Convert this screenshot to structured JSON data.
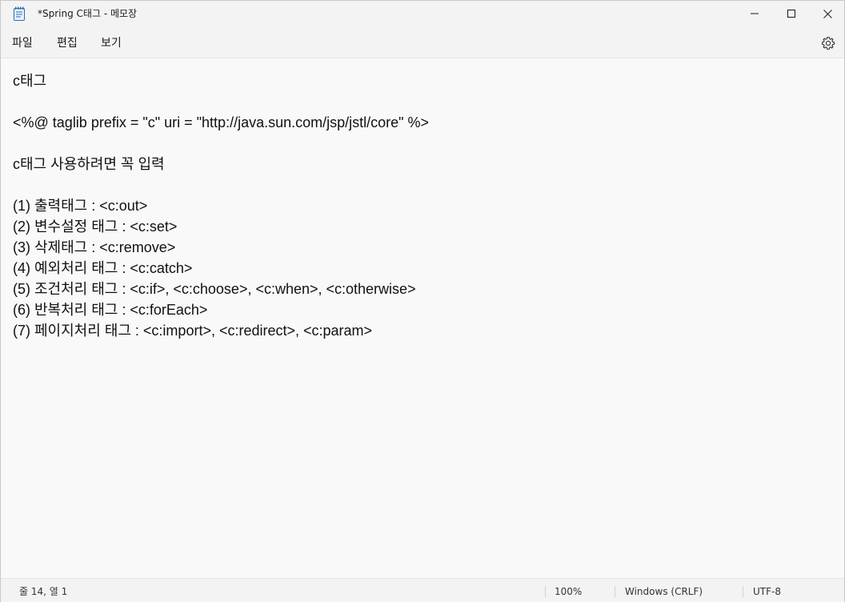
{
  "window": {
    "title": "*Spring C태그 - 메모장",
    "app_icon": "notepad-icon"
  },
  "menu": {
    "file": "파일",
    "edit": "편집",
    "view": "보기",
    "settings_icon": "gear-icon"
  },
  "document": {
    "lines": [
      "c태그",
      "",
      "<%@ taglib prefix = \"c\" uri = \"http://java.sun.com/jsp/jstl/core\" %>",
      "",
      "c태그 사용하려면 꼭 입력",
      "",
      "(1) 출력태그 : <c:out>",
      "(2) 변수설정 태그 : <c:set>",
      "(3) 삭제태그 : <c:remove>",
      "(4) 예외처리 태그 : <c:catch>",
      "(5) 조건처리 태그 : <c:if>, <c:choose>, <c:when>, <c:otherwise>",
      "(6) 반복처리 태그 : <c:forEach>",
      "(7) 페이지처리 태그 : <c:import>, <c:redirect>, <c:param>"
    ]
  },
  "status": {
    "position": "줄 14, 열 1",
    "zoom": "100%",
    "line_ending": "Windows (CRLF)",
    "encoding": "UTF-8"
  },
  "colors": {
    "chrome": "#f3f3f3",
    "editor_bg": "#f9f9f9",
    "icon_blue": "#2b6cb0"
  }
}
